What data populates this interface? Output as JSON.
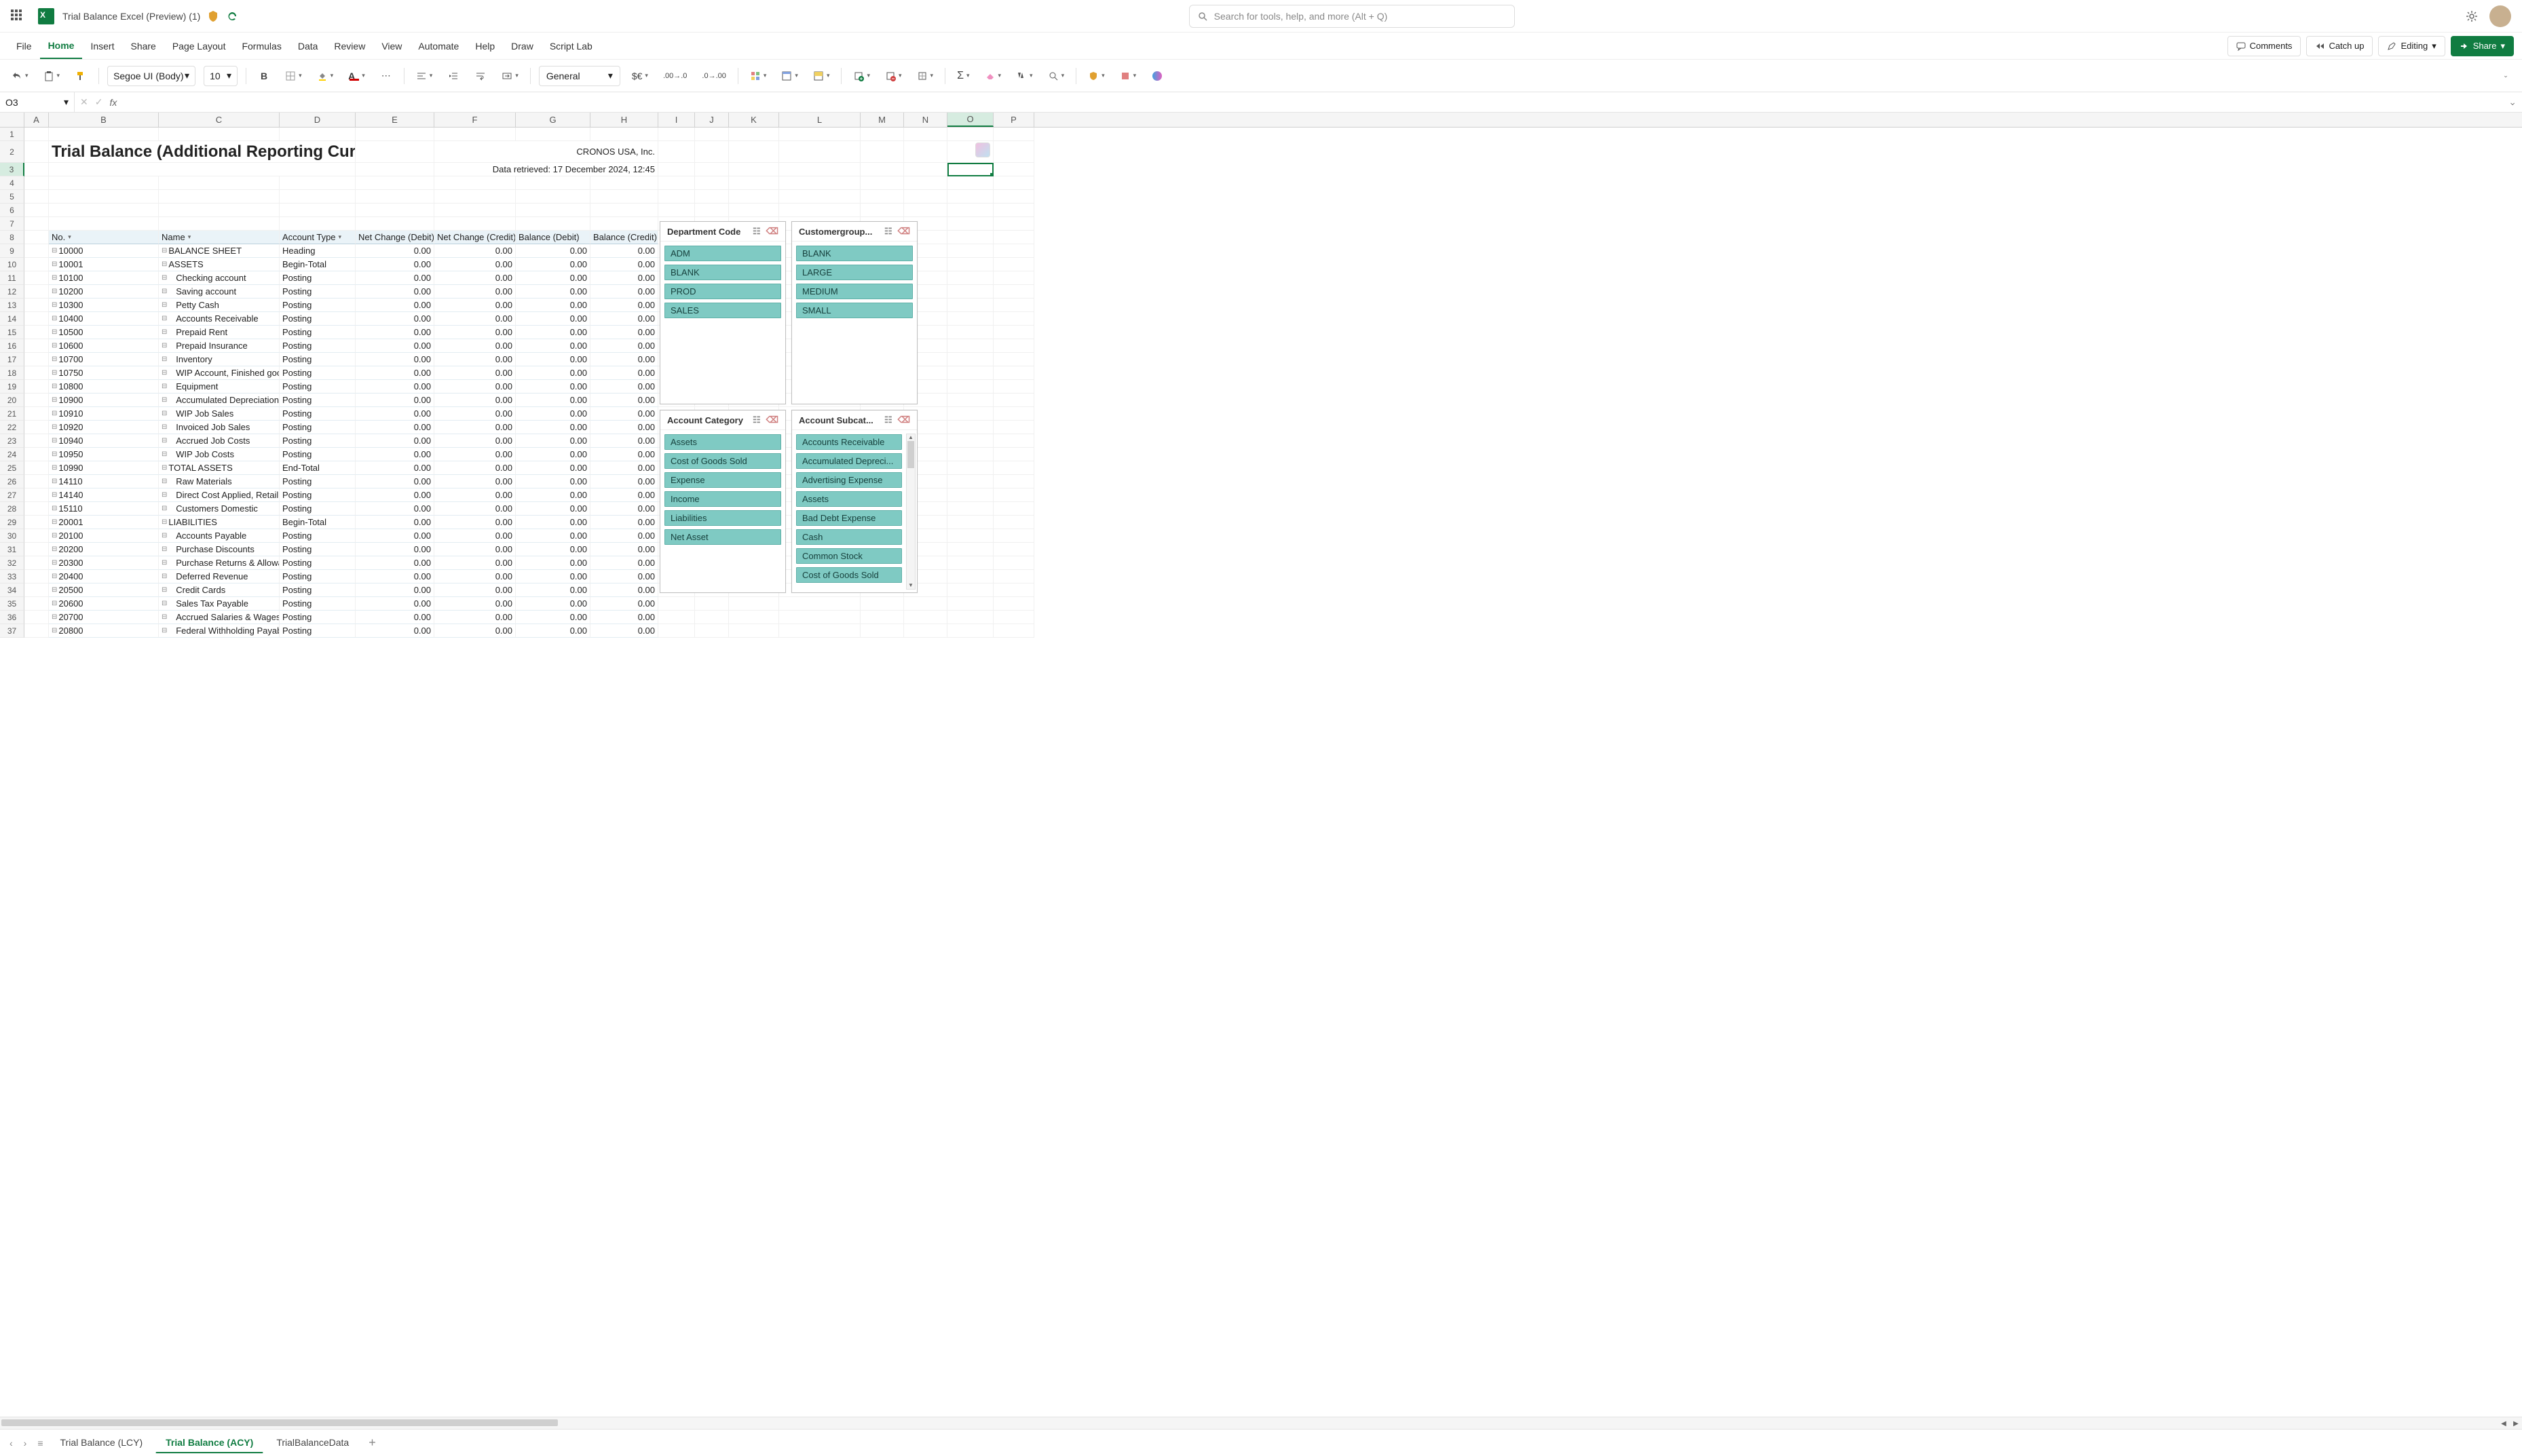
{
  "title": {
    "doc": "Trial Balance Excel (Preview) (1)",
    "search_ph": "Search for tools, help, and more (Alt + Q)"
  },
  "menu": {
    "items": [
      "File",
      "Home",
      "Insert",
      "Share",
      "Page Layout",
      "Formulas",
      "Data",
      "Review",
      "View",
      "Automate",
      "Help",
      "Draw",
      "Script Lab"
    ],
    "active": 1,
    "comments": "Comments",
    "catchup": "Catch up",
    "editing": "Editing",
    "share": "Share"
  },
  "ribbon": {
    "font": "Segoe UI (Body)",
    "size": "10",
    "numfmt": "General"
  },
  "namebox": "O3",
  "cols": [
    "A",
    "B",
    "C",
    "D",
    "E",
    "F",
    "G",
    "H",
    "I",
    "J",
    "K",
    "L",
    "M",
    "N",
    "O",
    "P"
  ],
  "report": {
    "title": "Trial Balance (Additional Reporting Currency)",
    "company": "CRONOS USA, Inc.",
    "retrieved": "Data retrieved: 17 December 2024, 12:45"
  },
  "hdr": {
    "no": "No.",
    "name": "Name",
    "atype": "Account Type",
    "ncd": "Net Change (Debit)",
    "ncc": "Net Change (Credit)",
    "bd": "Balance (Debit)",
    "bc": "Balance (Credit)"
  },
  "rows": [
    {
      "no": "10000",
      "name": "BALANCE SHEET",
      "atype": "Heading",
      "v": [
        "0.00",
        "0.00",
        "0.00",
        "0.00"
      ],
      "lvl": 0
    },
    {
      "no": "10001",
      "name": "ASSETS",
      "atype": "Begin-Total",
      "v": [
        "0.00",
        "0.00",
        "0.00",
        "0.00"
      ],
      "lvl": 0
    },
    {
      "no": "10100",
      "name": "Checking account",
      "atype": "Posting",
      "v": [
        "0.00",
        "0.00",
        "0.00",
        "0.00"
      ],
      "lvl": 1
    },
    {
      "no": "10200",
      "name": "Saving account",
      "atype": "Posting",
      "v": [
        "0.00",
        "0.00",
        "0.00",
        "0.00"
      ],
      "lvl": 1
    },
    {
      "no": "10300",
      "name": "Petty Cash",
      "atype": "Posting",
      "v": [
        "0.00",
        "0.00",
        "0.00",
        "0.00"
      ],
      "lvl": 1
    },
    {
      "no": "10400",
      "name": "Accounts Receivable",
      "atype": "Posting",
      "v": [
        "0.00",
        "0.00",
        "0.00",
        "0.00"
      ],
      "lvl": 1
    },
    {
      "no": "10500",
      "name": "Prepaid Rent",
      "atype": "Posting",
      "v": [
        "0.00",
        "0.00",
        "0.00",
        "0.00"
      ],
      "lvl": 1
    },
    {
      "no": "10600",
      "name": "Prepaid Insurance",
      "atype": "Posting",
      "v": [
        "0.00",
        "0.00",
        "0.00",
        "0.00"
      ],
      "lvl": 1
    },
    {
      "no": "10700",
      "name": "Inventory",
      "atype": "Posting",
      "v": [
        "0.00",
        "0.00",
        "0.00",
        "0.00"
      ],
      "lvl": 1
    },
    {
      "no": "10750",
      "name": "WIP Account, Finished good",
      "atype": "Posting",
      "v": [
        "0.00",
        "0.00",
        "0.00",
        "0.00"
      ],
      "lvl": 1
    },
    {
      "no": "10800",
      "name": "Equipment",
      "atype": "Posting",
      "v": [
        "0.00",
        "0.00",
        "0.00",
        "0.00"
      ],
      "lvl": 1
    },
    {
      "no": "10900",
      "name": "Accumulated Depreciation",
      "atype": "Posting",
      "v": [
        "0.00",
        "0.00",
        "0.00",
        "0.00"
      ],
      "lvl": 1
    },
    {
      "no": "10910",
      "name": "WIP Job Sales",
      "atype": "Posting",
      "v": [
        "0.00",
        "0.00",
        "0.00",
        "0.00"
      ],
      "lvl": 1
    },
    {
      "no": "10920",
      "name": "Invoiced Job Sales",
      "atype": "Posting",
      "v": [
        "0.00",
        "0.00",
        "0.00",
        "0.00"
      ],
      "lvl": 1
    },
    {
      "no": "10940",
      "name": "Accrued Job Costs",
      "atype": "Posting",
      "v": [
        "0.00",
        "0.00",
        "0.00",
        "0.00"
      ],
      "lvl": 1
    },
    {
      "no": "10950",
      "name": "WIP Job Costs",
      "atype": "Posting",
      "v": [
        "0.00",
        "0.00",
        "0.00",
        "0.00"
      ],
      "lvl": 1
    },
    {
      "no": "10990",
      "name": "TOTAL ASSETS",
      "atype": "End-Total",
      "v": [
        "0.00",
        "0.00",
        "0.00",
        "0.00"
      ],
      "lvl": 0
    },
    {
      "no": "14110",
      "name": "Raw Materials",
      "atype": "Posting",
      "v": [
        "0.00",
        "0.00",
        "0.00",
        "0.00"
      ],
      "lvl": 1
    },
    {
      "no": "14140",
      "name": "Direct Cost Applied, Retail",
      "atype": "Posting",
      "v": [
        "0.00",
        "0.00",
        "0.00",
        "0.00"
      ],
      "lvl": 1
    },
    {
      "no": "15110",
      "name": "Customers Domestic",
      "atype": "Posting",
      "v": [
        "0.00",
        "0.00",
        "0.00",
        "0.00"
      ],
      "lvl": 1
    },
    {
      "no": "20001",
      "name": "LIABILITIES",
      "atype": "Begin-Total",
      "v": [
        "0.00",
        "0.00",
        "0.00",
        "0.00"
      ],
      "lvl": 0
    },
    {
      "no": "20100",
      "name": "Accounts Payable",
      "atype": "Posting",
      "v": [
        "0.00",
        "0.00",
        "0.00",
        "0.00"
      ],
      "lvl": 1
    },
    {
      "no": "20200",
      "name": "Purchase Discounts",
      "atype": "Posting",
      "v": [
        "0.00",
        "0.00",
        "0.00",
        "0.00"
      ],
      "lvl": 1
    },
    {
      "no": "20300",
      "name": "Purchase Returns & Allowan",
      "atype": "Posting",
      "v": [
        "0.00",
        "0.00",
        "0.00",
        "0.00"
      ],
      "lvl": 1
    },
    {
      "no": "20400",
      "name": "Deferred Revenue",
      "atype": "Posting",
      "v": [
        "0.00",
        "0.00",
        "0.00",
        "0.00"
      ],
      "lvl": 1
    },
    {
      "no": "20500",
      "name": "Credit Cards",
      "atype": "Posting",
      "v": [
        "0.00",
        "0.00",
        "0.00",
        "0.00"
      ],
      "lvl": 1
    },
    {
      "no": "20600",
      "name": "Sales Tax Payable",
      "atype": "Posting",
      "v": [
        "0.00",
        "0.00",
        "0.00",
        "0.00"
      ],
      "lvl": 1
    },
    {
      "no": "20700",
      "name": "Accrued Salaries & Wages",
      "atype": "Posting",
      "v": [
        "0.00",
        "0.00",
        "0.00",
        "0.00"
      ],
      "lvl": 1
    },
    {
      "no": "20800",
      "name": "Federal Withholding Payabl",
      "atype": "Posting",
      "v": [
        "0.00",
        "0.00",
        "0.00",
        "0.00"
      ],
      "lvl": 1
    }
  ],
  "slicers": {
    "dept": {
      "title": "Department Code",
      "items": [
        "ADM",
        "BLANK",
        "PROD",
        "SALES"
      ]
    },
    "cust": {
      "title": "Customergroup...",
      "items": [
        "BLANK",
        "LARGE",
        "MEDIUM",
        "SMALL"
      ]
    },
    "acat": {
      "title": "Account Category",
      "items": [
        "Assets",
        "Cost of Goods Sold",
        "Expense",
        "Income",
        "Liabilities",
        "Net Asset"
      ]
    },
    "asub": {
      "title": "Account Subcat...",
      "items": [
        "Accounts Receivable",
        "Accumulated Depreci...",
        "Advertising Expense",
        "Assets",
        "Bad Debt Expense",
        "Cash",
        "Common Stock",
        "Cost of Goods Sold"
      ]
    }
  },
  "tabs": {
    "items": [
      "Trial Balance (LCY)",
      "Trial Balance (ACY)",
      "TrialBalanceData"
    ],
    "active": 1
  }
}
